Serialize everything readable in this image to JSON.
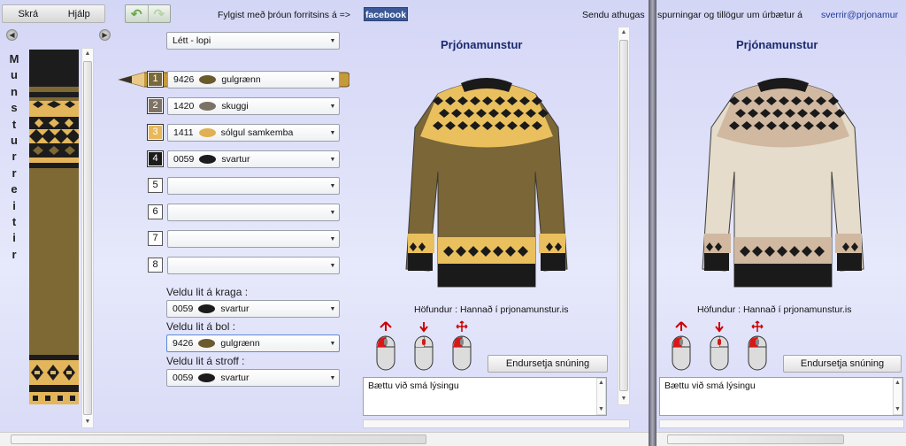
{
  "menu": {
    "file": "Skrá",
    "help": "Hjálp"
  },
  "header": {
    "follow_text": "Fylgist með þróun forritsins á =>",
    "facebook": "facebook",
    "send_text": "Sendu athugas",
    "send_text2": "spurningar og tillögur um úrbætur á",
    "email": "sverrir@prjonamur"
  },
  "side_title": "Munsturreitir",
  "yarn_type": "Létt - lopi",
  "colors": [
    {
      "n": "1",
      "code": "9426",
      "name": "gulgrænn",
      "swatch": "#6b5a2c",
      "box": "#7a6a3a"
    },
    {
      "n": "2",
      "code": "1420",
      "name": "skuggi",
      "swatch": "#7b7165",
      "box": "#7d7366"
    },
    {
      "n": "3",
      "code": "1411",
      "name": "sólgul samkemba",
      "swatch": "#e0b052",
      "box": "#e8b85a"
    },
    {
      "n": "4",
      "code": "0059",
      "name": "svartur",
      "swatch": "#1c1c1c",
      "box": "#1c1c1c"
    },
    {
      "n": "5",
      "code": "",
      "name": "",
      "swatch": "",
      "box": ""
    },
    {
      "n": "6",
      "code": "",
      "name": "",
      "swatch": "",
      "box": ""
    },
    {
      "n": "7",
      "code": "",
      "name": "",
      "swatch": "",
      "box": ""
    },
    {
      "n": "8",
      "code": "",
      "name": "",
      "swatch": "",
      "box": ""
    }
  ],
  "collar": {
    "label": "Veldu lit á kraga :",
    "code": "0059",
    "name": "svartur",
    "swatch": "#1c1c1c"
  },
  "body": {
    "label": "Veldu lit á bol :",
    "code": "9426",
    "name": "gulgrænn",
    "swatch": "#6b5a2c"
  },
  "cuff": {
    "label": "Veldu lit á stroff :",
    "code": "0059",
    "name": "svartur",
    "swatch": "#1c1c1c"
  },
  "preview1": {
    "title": "Prjónamunstur",
    "author": "Höfundur : Hannað í prjonamunstur.is",
    "reset": "Endursetja snúning",
    "description": "Bættu við smá lýsingu",
    "sweater_base": "#7a6636",
    "sweater_accent": "#eac05e",
    "sweater_dark": "#1a1a1a"
  },
  "preview2": {
    "title": "Prjónamunstur",
    "author": "Höfundur : Hannað í prjonamunstur.is",
    "reset": "Endursetja snúning",
    "description": "Bættu við smá lýsingu",
    "sweater_base": "#e6dccb",
    "sweater_accent": "#d1b8a0",
    "sweater_dark": "#1a1a1a"
  }
}
